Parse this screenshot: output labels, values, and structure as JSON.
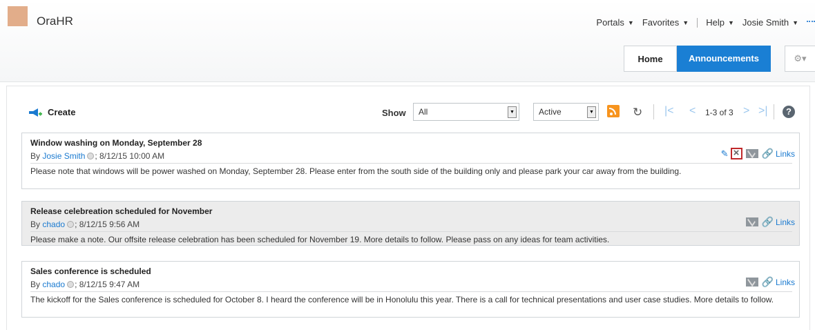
{
  "app": {
    "title": "OraHR"
  },
  "global_nav": {
    "portals": "Portals",
    "favorites": "Favorites",
    "help": "Help",
    "user": "Josie Smith",
    "caret": "▼"
  },
  "tabs": {
    "home": "Home",
    "announcements": "Announcements"
  },
  "toolbar": {
    "create_label": "Create",
    "show_label": "Show",
    "show_filter_value": "All",
    "status_filter_value": "Active",
    "pager_text": "1-3 of 3",
    "help_glyph": "?"
  },
  "icons": {
    "refresh": "↻",
    "first_page": "|<",
    "prev_page": "<",
    "next_page": ">",
    "last_page": ">|",
    "gear": "⚙▾",
    "edit": "✎",
    "delete": "×",
    "link": "🔗"
  },
  "announcements": [
    {
      "title": "Window washing on Monday, September 28",
      "by": "By",
      "author": "Josie Smith",
      "date": "; 8/12/15 10:00 AM",
      "body": "Please note that windows will be power washed on Monday, September 28. Please enter from the south side of the building only and please park your car away from the building.",
      "links_label": "Links"
    },
    {
      "title": "Release celebreation scheduled for November",
      "by": "By",
      "author": "chado",
      "date": "; 8/12/15 9:56 AM",
      "body": "Please make a note. Our offsite release celebration has been scheduled for November 19. More details to follow. Please pass on any ideas for team activities.",
      "links_label": "Links"
    },
    {
      "title": "Sales conference is scheduled",
      "by": "By",
      "author": "chado",
      "date": "; 8/12/15 9:47 AM",
      "body": "The kickoff for the Sales conference is scheduled for October 8. I heard the conference will be in Honolulu this year. There is a call for technical presentations and user case studies. More details to follow.",
      "links_label": "Links"
    }
  ],
  "colors": {
    "accent": "#1a7fd4",
    "link": "#1a7ad0",
    "rss": "#f7941e",
    "delete_highlight": "#c0292b"
  }
}
